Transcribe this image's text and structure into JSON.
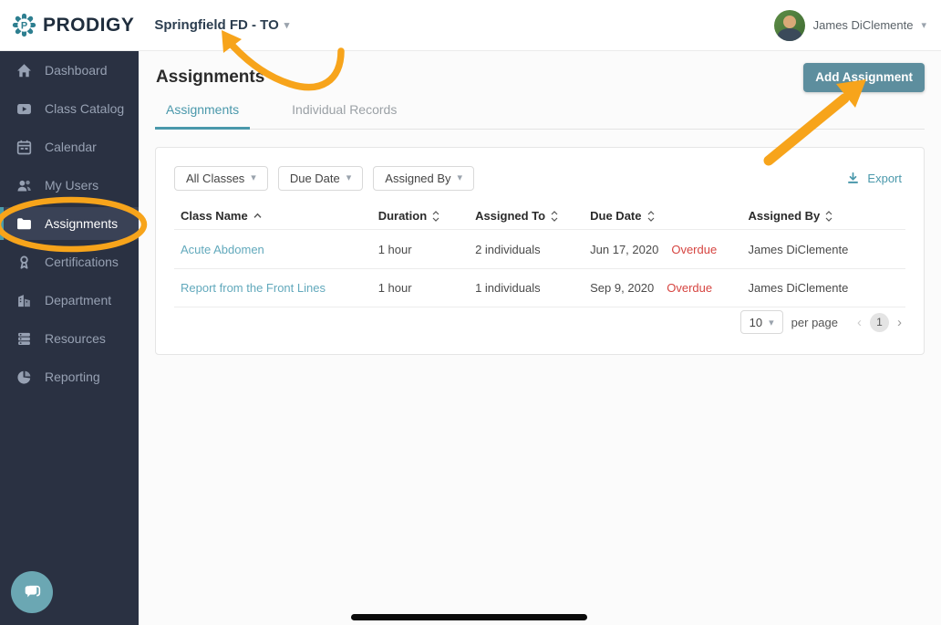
{
  "topbar": {
    "brand": "PRODIGY",
    "org_switcher": "Springfield FD - TO",
    "user_name": "James DiClemente"
  },
  "sidebar": {
    "items": [
      {
        "label": "Dashboard",
        "icon": "home-icon",
        "active": false
      },
      {
        "label": "Class Catalog",
        "icon": "video-icon",
        "active": false
      },
      {
        "label": "Calendar",
        "icon": "calendar-icon",
        "active": false
      },
      {
        "label": "My Users",
        "icon": "users-icon",
        "active": false
      },
      {
        "label": "Assignments",
        "icon": "folder-icon",
        "active": true
      },
      {
        "label": "Certifications",
        "icon": "award-icon",
        "active": false
      },
      {
        "label": "Department",
        "icon": "building-icon",
        "active": false
      },
      {
        "label": "Resources",
        "icon": "server-icon",
        "active": false
      },
      {
        "label": "Reporting",
        "icon": "pie-chart-icon",
        "active": false
      }
    ]
  },
  "main": {
    "title": "Assignments",
    "tabs": [
      {
        "label": "Assignments",
        "active": true
      },
      {
        "label": "Individual Records",
        "active": false
      }
    ],
    "add_button_label": "Add Assignment",
    "filters": [
      {
        "label": "All Classes"
      },
      {
        "label": "Due Date"
      },
      {
        "label": "Assigned By"
      }
    ],
    "export_label": "Export",
    "table": {
      "columns": [
        {
          "label": "Class Name",
          "sort": "asc"
        },
        {
          "label": "Duration",
          "sort": "both"
        },
        {
          "label": "Assigned To",
          "sort": "both"
        },
        {
          "label": "Due Date",
          "sort": "both"
        },
        {
          "label": "Assigned By",
          "sort": "both"
        }
      ],
      "rows": [
        {
          "class_name": "Acute Abdomen",
          "duration": "1 hour",
          "assigned_to": "2 individuals",
          "due_date": "Jun 17, 2020",
          "status": "Overdue",
          "assigned_by": "James DiClemente"
        },
        {
          "class_name": "Report from the Front Lines",
          "duration": "1 hour",
          "assigned_to": "1 individuals",
          "due_date": "Sep 9, 2020",
          "status": "Overdue",
          "assigned_by": "James DiClemente"
        }
      ]
    },
    "pagination": {
      "page_size": "10",
      "per_page_label": "per page",
      "current_page": "1"
    }
  },
  "colors": {
    "accent_teal": "#4a98ab",
    "button_teal": "#5d8e9e",
    "sidebar_bg": "#2a3142",
    "annotation_orange": "#F7A41B",
    "overdue_red": "#d64541",
    "link_teal": "#62a9bc"
  }
}
